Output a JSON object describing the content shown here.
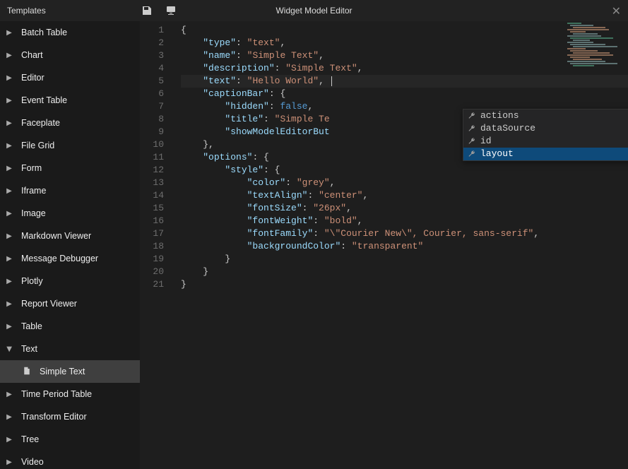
{
  "header": {
    "left_title": "Templates",
    "center_title": "Widget Model Editor"
  },
  "sidebar": {
    "items": [
      {
        "label": "Batch Table",
        "expanded": false
      },
      {
        "label": "Chart",
        "expanded": false
      },
      {
        "label": "Editor",
        "expanded": false
      },
      {
        "label": "Event Table",
        "expanded": false
      },
      {
        "label": "Faceplate",
        "expanded": false
      },
      {
        "label": "File Grid",
        "expanded": false
      },
      {
        "label": "Form",
        "expanded": false
      },
      {
        "label": "Iframe",
        "expanded": false
      },
      {
        "label": "Image",
        "expanded": false
      },
      {
        "label": "Markdown Viewer",
        "expanded": false
      },
      {
        "label": "Message Debugger",
        "expanded": false
      },
      {
        "label": "Plotly",
        "expanded": false
      },
      {
        "label": "Report Viewer",
        "expanded": false
      },
      {
        "label": "Table",
        "expanded": false
      },
      {
        "label": "Text",
        "expanded": true,
        "children": [
          {
            "label": "Simple Text",
            "selected": true
          }
        ]
      },
      {
        "label": "Time Period Table",
        "expanded": false
      },
      {
        "label": "Transform Editor",
        "expanded": false
      },
      {
        "label": "Tree",
        "expanded": false
      },
      {
        "label": "Video",
        "expanded": false
      }
    ]
  },
  "autocomplete": {
    "items": [
      {
        "label": "actions"
      },
      {
        "label": "dataSource"
      },
      {
        "label": "id"
      },
      {
        "label": "layout",
        "selected": true
      }
    ]
  },
  "code_model": {
    "type": "text",
    "name": "Simple Text",
    "description": "Simple Text",
    "text": "Hello World",
    "captionBar": {
      "hidden": false,
      "title": "Simple Te",
      "showModelEditorBut": ""
    },
    "options": {
      "style": {
        "color": "grey",
        "textAlign": "center",
        "fontSize": "26px",
        "fontWeight": "bold",
        "fontFamily": "\\\"Courier New\\\", Courier, sans-serif",
        "backgroundColor": "transparent"
      }
    }
  },
  "code_lines": [
    {
      "n": 1,
      "tokens": [
        {
          "t": "{",
          "c": "brace"
        }
      ]
    },
    {
      "n": 2,
      "indent": 2,
      "tokens": [
        {
          "t": "\"type\"",
          "c": "key"
        },
        {
          "t": ": ",
          "c": "punct"
        },
        {
          "t": "\"text\"",
          "c": "str"
        },
        {
          "t": ",",
          "c": "punct"
        }
      ]
    },
    {
      "n": 3,
      "indent": 2,
      "tokens": [
        {
          "t": "\"name\"",
          "c": "key"
        },
        {
          "t": ": ",
          "c": "punct"
        },
        {
          "t": "\"Simple Text\"",
          "c": "str"
        },
        {
          "t": ",",
          "c": "punct"
        }
      ]
    },
    {
      "n": 4,
      "indent": 2,
      "tokens": [
        {
          "t": "\"description\"",
          "c": "key"
        },
        {
          "t": ": ",
          "c": "punct"
        },
        {
          "t": "\"Simple Text\"",
          "c": "str"
        },
        {
          "t": ",",
          "c": "punct"
        }
      ]
    },
    {
      "n": 5,
      "indent": 2,
      "hl": true,
      "cursor": true,
      "tokens": [
        {
          "t": "\"text\"",
          "c": "key"
        },
        {
          "t": ": ",
          "c": "punct"
        },
        {
          "t": "\"Hello World\"",
          "c": "str"
        },
        {
          "t": ", ",
          "c": "punct"
        }
      ]
    },
    {
      "n": 6,
      "indent": 2,
      "tokens": [
        {
          "t": "\"captionBar\"",
          "c": "key"
        },
        {
          "t": ": {",
          "c": "punct"
        }
      ]
    },
    {
      "n": 7,
      "indent": 4,
      "tokens": [
        {
          "t": "\"hidden\"",
          "c": "key"
        },
        {
          "t": ": ",
          "c": "punct"
        },
        {
          "t": "false",
          "c": "bool"
        },
        {
          "t": ",",
          "c": "punct"
        }
      ]
    },
    {
      "n": 8,
      "indent": 4,
      "tokens": [
        {
          "t": "\"title\"",
          "c": "key"
        },
        {
          "t": ": ",
          "c": "punct"
        },
        {
          "t": "\"Simple Te",
          "c": "str"
        }
      ]
    },
    {
      "n": 9,
      "indent": 4,
      "tokens": [
        {
          "t": "\"showModelEditorBut",
          "c": "key"
        }
      ]
    },
    {
      "n": 10,
      "indent": 2,
      "tokens": [
        {
          "t": "},",
          "c": "punct"
        }
      ]
    },
    {
      "n": 11,
      "indent": 2,
      "tokens": [
        {
          "t": "\"options\"",
          "c": "key"
        },
        {
          "t": ": {",
          "c": "punct"
        }
      ]
    },
    {
      "n": 12,
      "indent": 4,
      "tokens": [
        {
          "t": "\"style\"",
          "c": "key"
        },
        {
          "t": ": {",
          "c": "punct"
        }
      ]
    },
    {
      "n": 13,
      "indent": 6,
      "tokens": [
        {
          "t": "\"color\"",
          "c": "key"
        },
        {
          "t": ": ",
          "c": "punct"
        },
        {
          "t": "\"grey\"",
          "c": "str"
        },
        {
          "t": ",",
          "c": "punct"
        }
      ]
    },
    {
      "n": 14,
      "indent": 6,
      "tokens": [
        {
          "t": "\"textAlign\"",
          "c": "key"
        },
        {
          "t": ": ",
          "c": "punct"
        },
        {
          "t": "\"center\"",
          "c": "str"
        },
        {
          "t": ",",
          "c": "punct"
        }
      ]
    },
    {
      "n": 15,
      "indent": 6,
      "tokens": [
        {
          "t": "\"fontSize\"",
          "c": "key"
        },
        {
          "t": ": ",
          "c": "punct"
        },
        {
          "t": "\"26px\"",
          "c": "str"
        },
        {
          "t": ",",
          "c": "punct"
        }
      ]
    },
    {
      "n": 16,
      "indent": 6,
      "tokens": [
        {
          "t": "\"fontWeight\"",
          "c": "key"
        },
        {
          "t": ": ",
          "c": "punct"
        },
        {
          "t": "\"bold\"",
          "c": "str"
        },
        {
          "t": ",",
          "c": "punct"
        }
      ]
    },
    {
      "n": 17,
      "indent": 6,
      "tokens": [
        {
          "t": "\"fontFamily\"",
          "c": "key"
        },
        {
          "t": ": ",
          "c": "punct"
        },
        {
          "t": "\"\\\"Courier New\\\", Courier, sans-serif\"",
          "c": "str"
        },
        {
          "t": ",",
          "c": "punct"
        }
      ]
    },
    {
      "n": 18,
      "indent": 6,
      "tokens": [
        {
          "t": "\"backgroundColor\"",
          "c": "key"
        },
        {
          "t": ": ",
          "c": "punct"
        },
        {
          "t": "\"transparent\"",
          "c": "str"
        }
      ]
    },
    {
      "n": 19,
      "indent": 4,
      "tokens": [
        {
          "t": "}",
          "c": "punct"
        }
      ]
    },
    {
      "n": 20,
      "indent": 2,
      "tokens": [
        {
          "t": "}",
          "c": "punct"
        }
      ]
    },
    {
      "n": 21,
      "tokens": [
        {
          "t": "}",
          "c": "brace"
        }
      ]
    }
  ]
}
